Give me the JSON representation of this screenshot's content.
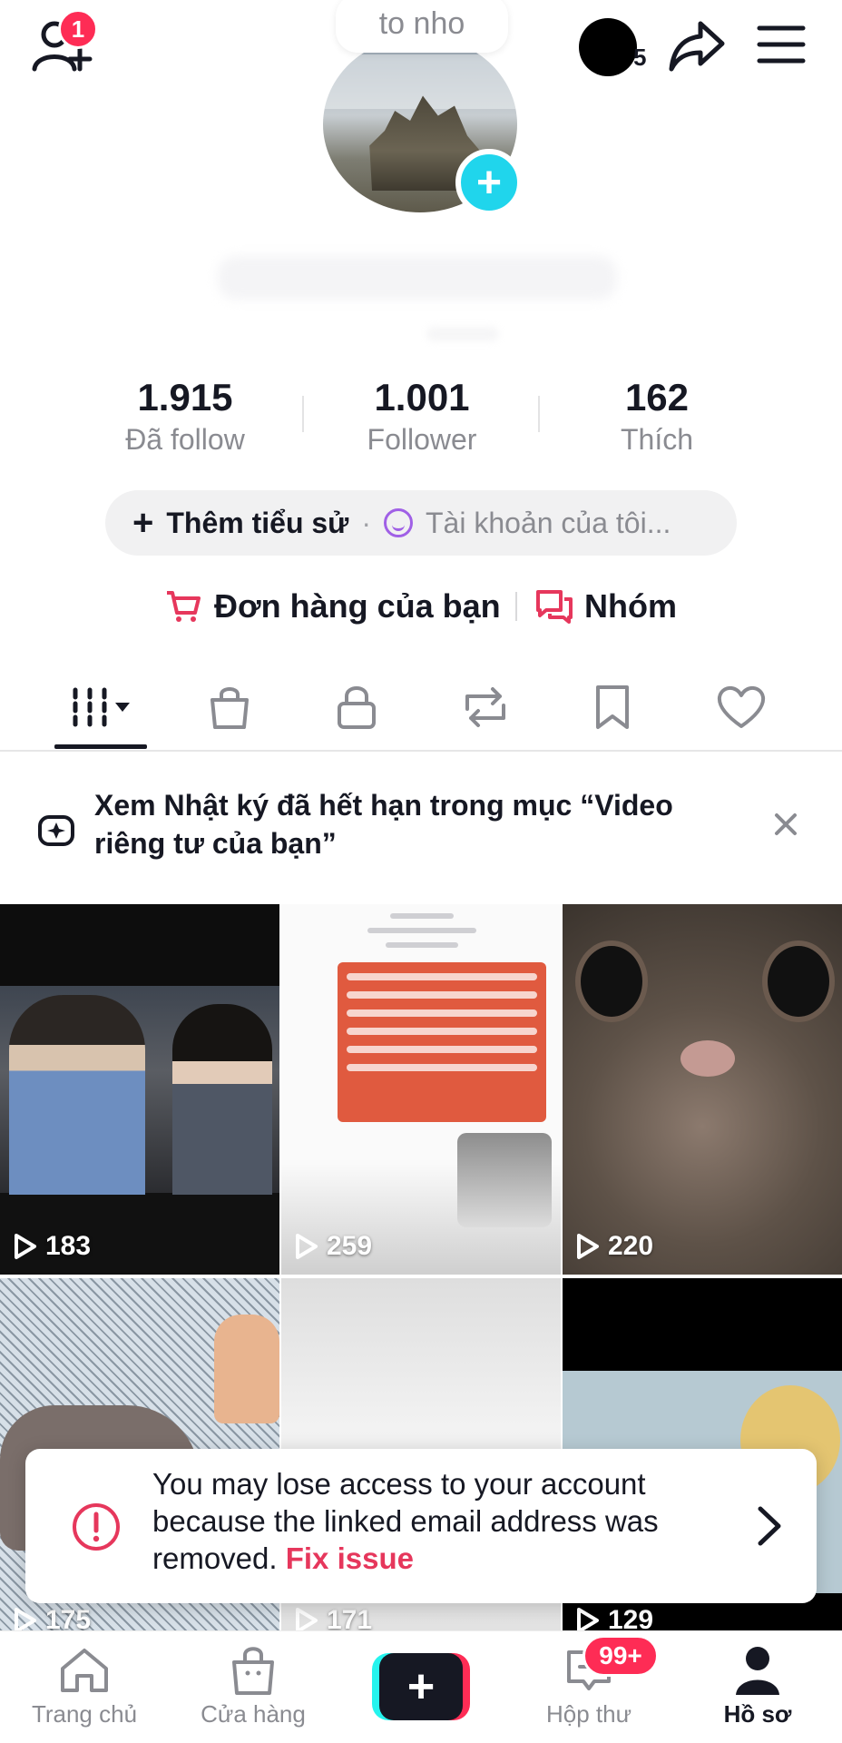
{
  "topbar": {
    "friend_requests": "1",
    "coin_count": "5"
  },
  "profile": {
    "note_text": "to nho"
  },
  "stats": [
    {
      "value": "1.915",
      "label": "Đã follow"
    },
    {
      "value": "1.001",
      "label": "Follower"
    },
    {
      "value": "162",
      "label": "Thích"
    }
  ],
  "bio": {
    "add_bio_label": "Thêm tiểu sử",
    "separator": "·",
    "account_hint": "Tài khoản của tôi..."
  },
  "links": {
    "orders_label": "Đơn hàng của bạn",
    "group_label": "Nhóm"
  },
  "notice": {
    "text": "Xem Nhật ký đã hết hạn trong mục “Video riêng tư của bạn”"
  },
  "videos": [
    {
      "views": "183"
    },
    {
      "views": "259"
    },
    {
      "views": "220"
    },
    {
      "views": "175"
    },
    {
      "views": "171"
    },
    {
      "views": "129"
    }
  ],
  "toast": {
    "message": "You may lose access to your account because the linked email address was removed. ",
    "action": "Fix issue"
  },
  "bottom_nav": {
    "home": "Trang chủ",
    "shop": "Cửa hàng",
    "create": "+",
    "inbox": "Hộp thư",
    "inbox_badge": "99+",
    "profile": "Hồ sơ"
  },
  "colors": {
    "accent": "#fe2c55",
    "cyan": "#20d5ec",
    "link_red": "#e6375c"
  }
}
